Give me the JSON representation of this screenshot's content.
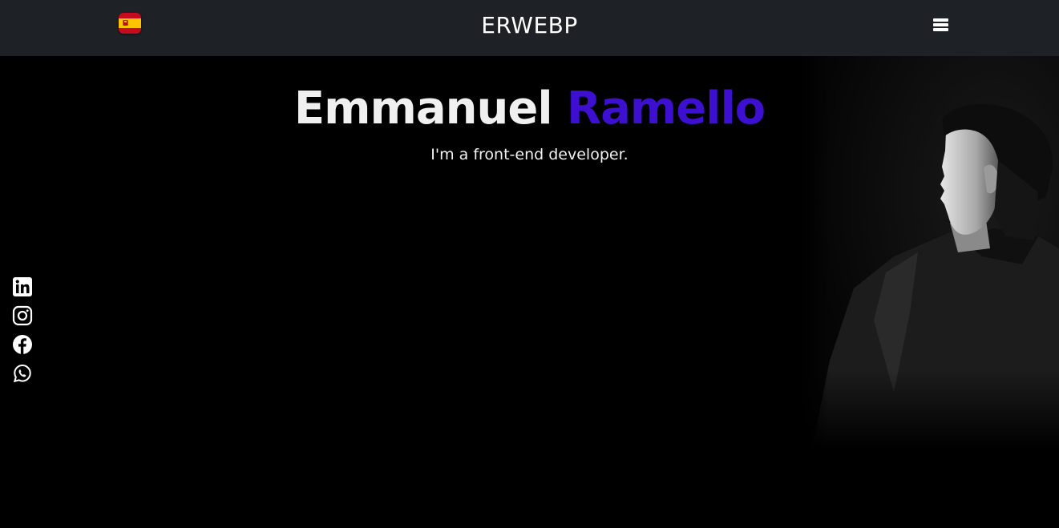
{
  "header": {
    "brand": "ERWEBP",
    "language_flag": "spain-flag-icon",
    "menu_icon": "hamburger-menu-icon"
  },
  "hero": {
    "first_name": "Emmanuel",
    "last_name": "Ramello",
    "subtitle": "I'm a front-end developer."
  },
  "social": [
    {
      "name": "linkedin-icon"
    },
    {
      "name": "instagram-icon"
    },
    {
      "name": "facebook-icon"
    },
    {
      "name": "whatsapp-icon"
    }
  ],
  "colors": {
    "navbar_bg": "#1e2125",
    "page_bg": "#000000",
    "accent": "#3c0fd1",
    "text": "#f0f0f0"
  }
}
